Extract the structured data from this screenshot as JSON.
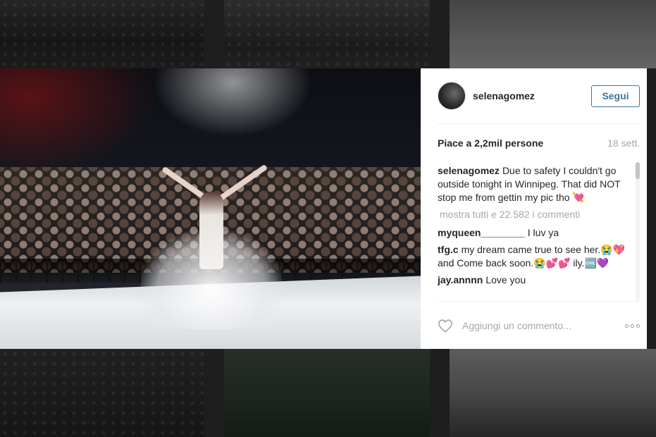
{
  "post": {
    "username": "selenagomez",
    "follow_label": "Segui",
    "likes": "Piace a 2,2mil persone",
    "age": "18 sett.",
    "caption_user": "selenagomez",
    "caption_text": "Due to safety I couldn't go outside tonight in Winnipeg. That did NOT stop me from gettin my pic tho 💘",
    "view_all": "mostra tutti e 22.582 i commenti",
    "comments": [
      {
        "user": "myqueen________",
        "text": "I luv ya"
      },
      {
        "user": "tfg.c",
        "text": "my dream came true to see her.😭💖 and Come back soon.😭💕💕 ily.🆒💜"
      },
      {
        "user": "jay.annnn",
        "text": "Love you"
      }
    ],
    "add_comment_placeholder": "Aggiungi un commento...",
    "more_options": "•••"
  },
  "icons": {
    "heart": "heart-outline-icon",
    "more": "more-options-icon"
  },
  "colors": {
    "follow_blue": "#3f729b",
    "muted_text": "#a5a7aa"
  }
}
